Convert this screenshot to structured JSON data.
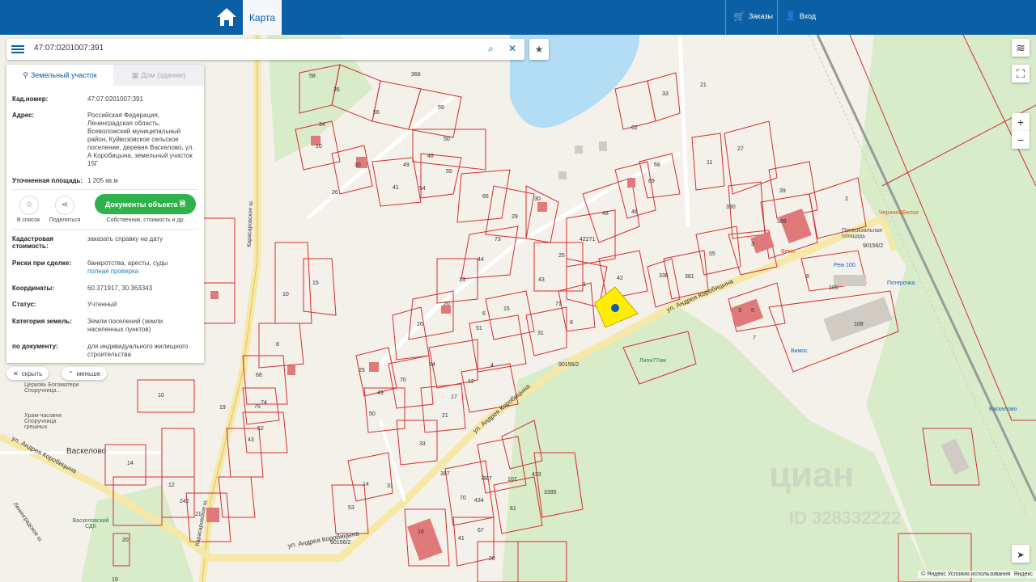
{
  "header": {
    "map_tab": "Карта",
    "orders": "Заказы",
    "login": "Вход"
  },
  "search": {
    "value": "47:07:0201007:391"
  },
  "panel": {
    "tab_land": "Земельный участок",
    "tab_house": "Дом (здание)",
    "rows": {
      "cad_number": {
        "k": "Кад.номер:",
        "v": "47:07:0201007:391"
      },
      "address": {
        "k": "Адрес:",
        "v": "Российская Федерация, Ленинградская область, Всеволожский муниципальный район, Куйвозовское сельское поселение, деревня Васкелово, ул. А Коробицына, земельный участок 15Г"
      },
      "area": {
        "k": "Уточненная площадь:",
        "v": "1 205 кв.м"
      },
      "cad_cost": {
        "k": "Кадастровая стоимость:",
        "v": "заказать справку на дату"
      },
      "risks": {
        "k": "Риски при сделке:",
        "v": "банкротства, аресты, суды",
        "v2": "полная проверка"
      },
      "coords": {
        "k": "Координаты:",
        "v": "60.371917, 30.363343"
      },
      "status": {
        "k": "Статус:",
        "v": "Учтенный"
      },
      "category": {
        "k": "Категория земель:",
        "v": "Земли поселений (земли населенных пунктов)"
      },
      "by_doc": {
        "k": "по документу:",
        "v": "для индивидуального жилищного строительства"
      }
    },
    "actions": {
      "to_list": "В список",
      "share": "Поделиться",
      "documents": "Документы объекта",
      "documents_sub": "Собственник, стоимость и др."
    }
  },
  "pills": {
    "hide": "скрыть",
    "less": "меньше"
  },
  "map": {
    "attribution": "© Яндекс Условия использования",
    "yandex": "Яндекс",
    "watermark": "циан",
    "watermark_id": "ID 328332222",
    "places": {
      "vaskelovo": "Васкелово",
      "vaskelovo_station": "Васкелово",
      "cdk": "Васкеловский СДК",
      "church1": "Церковь Богоматери Споручница...",
      "church2": "Храм-часовня Споручница грешных",
      "chernoe": "Черное&Белое",
      "square": "Привокзальная площадь",
      "vemo": "Вемо",
      "rem": "Рем 100",
      "pyaterochka": "Пятерочка",
      "vimos": "Вимос",
      "lion": "Лион77ам"
    },
    "streets": {
      "korobitsyna1": "ул. Андрея Коробицына",
      "korobitsyna2": "ул. Андрея Коробицына",
      "korobitsyna3": "ул. Андрея Коробицына",
      "korobitsyna4": "ул. Андрея Коробицына",
      "karas1": "Карасаровское ш.",
      "karas2": "Карасаровское ш.",
      "leningrad": "Ленинградское ш.",
      "road_90156": "90156/2",
      "road_90156b": "90156/2",
      "road_90156c": "90156/2"
    },
    "lot_numbers": [
      "58",
      "35",
      "368",
      "59",
      "56",
      "34",
      "50",
      "10",
      "48",
      "55",
      "30",
      "49",
      "41",
      "54",
      "26",
      "65",
      "30",
      "29",
      "73",
      "44",
      "13",
      "43",
      "25",
      "42271",
      "1",
      "42",
      "20",
      "15",
      "71",
      "8",
      "26",
      "31",
      "51",
      "6",
      "25",
      "70",
      "54",
      "12",
      "4",
      "49",
      "17",
      "50",
      "21",
      "33",
      "14",
      "31",
      "53",
      "16",
      "28",
      "41",
      "67",
      "70",
      "61",
      "107",
      "387",
      "434",
      "3395",
      "433",
      "2",
      "387",
      "48",
      "46",
      "69",
      "68",
      "33",
      "62",
      "21",
      "11",
      "27",
      "390",
      "39",
      "2",
      "389",
      "3",
      "105",
      "108",
      "381",
      "55",
      "336",
      "6",
      "5",
      "3",
      "7",
      "15",
      "10",
      "8",
      "68",
      "75",
      "74",
      "52",
      "43",
      "19",
      "242",
      "12",
      "21",
      "20",
      "19",
      "68",
      "10",
      "14"
    ]
  },
  "colors": {
    "brand": "#0b5fa5",
    "green": "#2fb14b",
    "link": "#1b7fcc",
    "lot": "#d32f2f",
    "selected": "#ffee00"
  }
}
